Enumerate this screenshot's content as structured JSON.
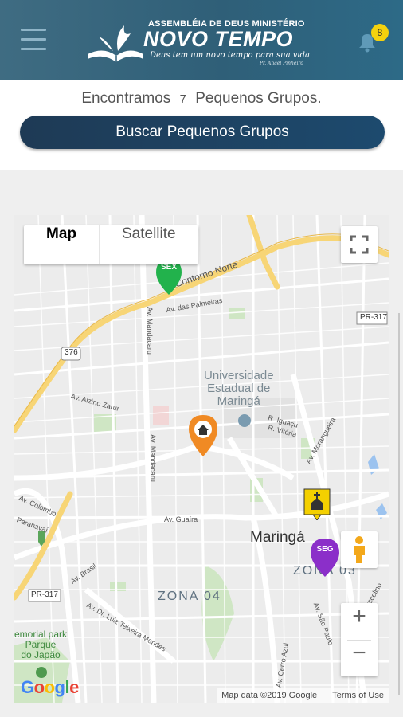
{
  "header": {
    "logo_line1": "ASSEMBLÉIA DE DEUS MINISTÉRIO",
    "logo_line2": "NOVO TEMPO",
    "logo_line3": "Deus tem um novo tempo para sua vida",
    "logo_line4": "Pr. Anael Pinheiro",
    "notification_count": "8"
  },
  "summary": {
    "prefix": "Encontramos",
    "count": "7",
    "suffix": "Pequenos Grupos."
  },
  "search_button": "Buscar Pequenos Grupos",
  "map": {
    "map_type_map": "Map",
    "map_type_satellite": "Satellite",
    "zoom_in": "+",
    "zoom_out": "−",
    "labels": {
      "contorno_norte": "Contorno Norte",
      "av_palmeiras": "Av. das Palmeiras",
      "pr317_top": "PR-317",
      "road376": "376",
      "av_mandacaru_top": "Av. Mandacaru",
      "av_mandacaru_mid": "Av. Mandacaru",
      "av_alzino": "Av. Alzino Zarur",
      "university_1": "Universidade",
      "university_2": "Estadual de",
      "university_3": "Maringá",
      "r_iguacu": "R. Iguaçu",
      "r_vitoria": "R. Vitória",
      "av_morangueira": "Av. Morangueira",
      "av_colombo": "Av. Colombo",
      "paranavai": "Paranavaí",
      "av_guaira": "Av. Guaíra",
      "maringa": "Maringá",
      "zona03": "ZONA 03",
      "zona04": "ZONA 04",
      "av_brasil": "Av. Brasil",
      "pr317_bottom": "PR-317",
      "av_luiz": "Av. Dr. Luiz Teixeira Mendes",
      "memorial_1": "emorial park",
      "memorial_2": "Parque",
      "memorial_3": "do Japão",
      "av_cerro": "Av. Cerro Azul",
      "av_sao_paulo": "Av. São Paulo",
      "av_juscelino": "Av. Juscelino"
    },
    "markers": {
      "sex": "SEX",
      "seg": "SEG"
    },
    "google_logo": "Google",
    "attribution": "Map data ©2019 Google",
    "terms": "Terms of Use"
  },
  "colors": {
    "header_bg": "#3a6a80",
    "button_bg": "#1e3f5c",
    "badge": "#f5d20d",
    "marker_sex": "#22b24c",
    "marker_seg": "#8b2fc9",
    "marker_home": "#f08a24",
    "church_marker": "#f4d000"
  }
}
